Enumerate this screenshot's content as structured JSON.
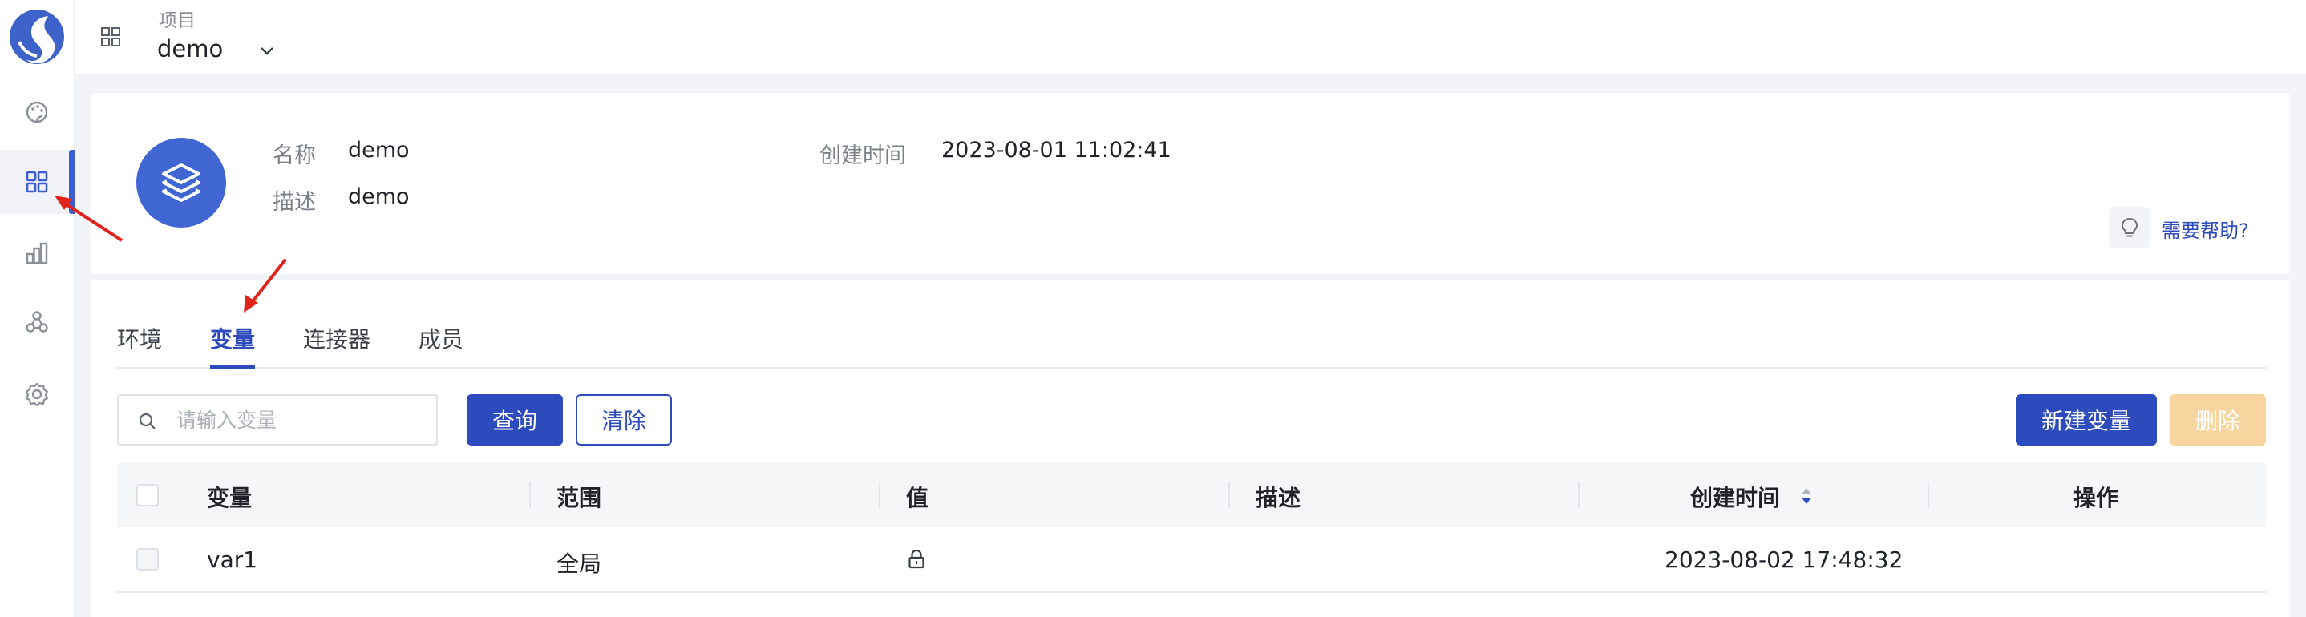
{
  "sidebar": {
    "logo": "app-logo",
    "items": [
      {
        "name": "dashboard",
        "icon": "palette-icon"
      },
      {
        "name": "projects",
        "icon": "grid-icon",
        "active": true
      },
      {
        "name": "analytics",
        "icon": "bar-chart-icon"
      },
      {
        "name": "resources",
        "icon": "nodes-icon"
      },
      {
        "name": "settings",
        "icon": "gear-icon"
      }
    ]
  },
  "header": {
    "project_label": "项目",
    "project_name": "demo"
  },
  "project_info": {
    "name_label": "名称",
    "name_value": "demo",
    "desc_label": "描述",
    "desc_value": "demo",
    "created_label": "创建时间",
    "created_value": "2023-08-01 11:02:41",
    "help_text": "需要帮助?"
  },
  "tabs": [
    {
      "label": "环境",
      "active": false
    },
    {
      "label": "变量",
      "active": true
    },
    {
      "label": "连接器",
      "active": false
    },
    {
      "label": "成员",
      "active": false
    }
  ],
  "toolbar": {
    "search_placeholder": "请输入变量",
    "query_label": "查询",
    "clear_label": "清除",
    "new_label": "新建变量",
    "delete_label": "删除"
  },
  "table": {
    "columns": [
      "变量",
      "范围",
      "值",
      "描述",
      "创建时间",
      "操作"
    ],
    "rows": [
      {
        "variable": "var1",
        "scope": "全局",
        "value": "lock-icon",
        "description": "",
        "created": "2023-08-02 17:48:32",
        "actions": ""
      }
    ]
  },
  "colors": {
    "accent": "#2e4bbd",
    "avatar": "#4066d4",
    "delete_disabled": "#f6d69e",
    "annotation": "#e0231b"
  }
}
